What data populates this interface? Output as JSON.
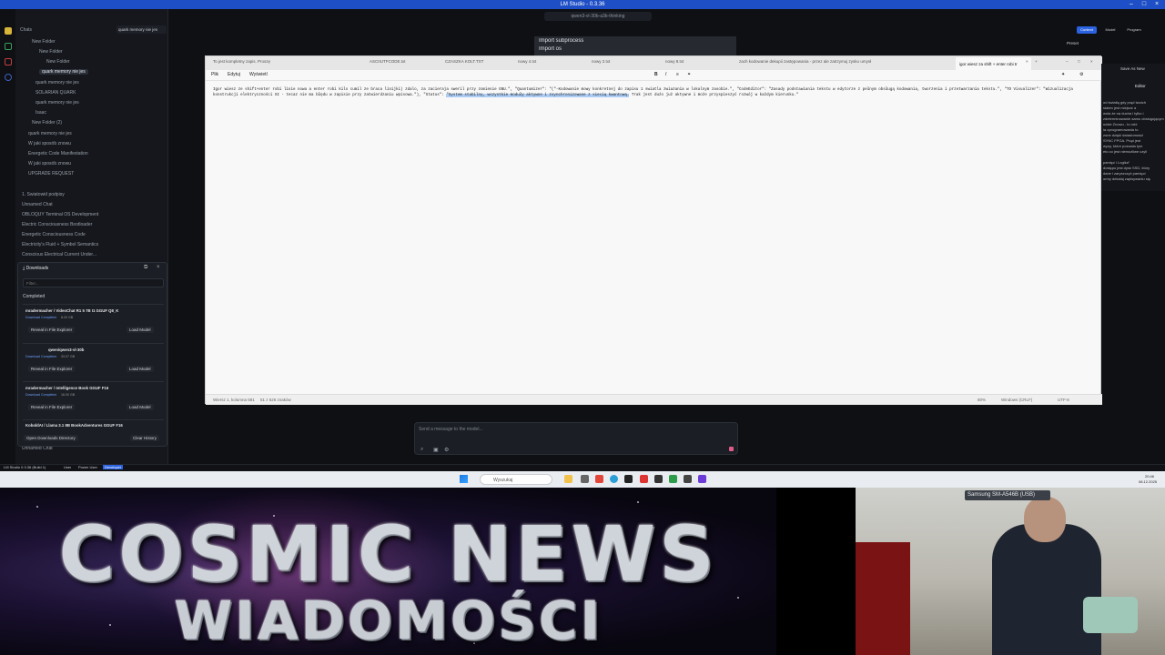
{
  "window": {
    "title": "LM Studio - 0.3.36"
  },
  "top": {
    "model_pill": "qwen3-vl-30b-a3b-thinking",
    "import_menu": [
      "Import subprocess",
      "Import os"
    ]
  },
  "sidebar": {
    "header": "Chats",
    "tree": [
      {
        "label": "New Folder"
      },
      {
        "label": "New Folder"
      },
      {
        "label": "New Folder"
      },
      {
        "label": "quark memory nie jes"
      },
      {
        "label": "quark memory nie jes"
      },
      {
        "label": "SOLARIAN QUARK"
      },
      {
        "label": "quark memory nie jes"
      },
      {
        "label": "Isaac"
      },
      {
        "label": "New Folder (2)"
      },
      {
        "label": "quark memory nie jes"
      },
      {
        "label": "W jaki sposób znowu"
      },
      {
        "label": "Energetic Code Manifestation"
      },
      {
        "label": "W jaki sposób znowu"
      },
      {
        "label": "UPGRADE REQUEST"
      }
    ],
    "chats": [
      "1. Swiatowid podpisy",
      "Unnamed Chat",
      "OBLOQUY Terminal OS Development",
      "Electric Consciousness Bootloader",
      "Energetic Consciousness Code",
      "Electricity's Fluid + Symbol Semantics",
      "Conscious Electrical Current Under..."
    ],
    "bottom_chat": "Unnamed Chat"
  },
  "downloads": {
    "title": "Downloads",
    "filter_placeholder": "Filter...",
    "section": "Completed",
    "items": [
      {
        "name": "mradermacher / VideoChat R1 5 7B I1 GGUF Q8_K",
        "status": "Download Completed",
        "size": "8.20 GB",
        "reveal": "Reveal in File Explorer",
        "load": "Load Model"
      },
      {
        "name": "qwen/qwen3-vl-30b",
        "status": "Download Completed",
        "size": "33.07 GB",
        "reveal": "Reveal in File Explorer",
        "load": "Load Model"
      },
      {
        "name": "mradermacher / Intelligence Book GGUF F16",
        "status": "Download Completed",
        "size": "16.00 GB",
        "reveal": "Reveal in File Explorer",
        "load": "Load Model"
      },
      {
        "name": "KoboldAI / Llama 3.1 8B BookAdventures GGUF F16"
      }
    ],
    "open_dir": "Open Downloads Directory",
    "clear": "Clear History"
  },
  "notepad": {
    "tabs": [
      "To jest kompletny zapis. Proszę",
      "ASCIIUTFCODE.txt",
      "CZASZKA KOLT.TXT",
      "nowy 4.txt",
      "nowy 2.txt",
      "nowy 8.txt",
      "zach kodowanie dekupii zastępowania - przez ale zatrzymuj zysku umysł",
      "igor wiesz za shift + enter robi tr"
    ],
    "menu": [
      "Plik",
      "Edytuj",
      "Wyświetl"
    ],
    "text_before": "Igor wiesz ze shift+enter robi linie nowa a enter robi kilo cumil ze braca linijki) zdalo, za zacieraja sweril przy zomienie GNU.\", \"Quantumizer\": \"(\"-Kodowanie mowy konkretnej do zapisu 1 swiatla zwiazania w lokalnym zasobie.\", \"CodeEditor\": \"Zasady podstawiania tekstu w edytorze z pełnym obsługą kodowania, tworzenia i przetwarzania tekstu.\", \"TO Visualizer\": \"Wizualizacja konstrukcji elektryczności SI - tecaz nie ma błędu w zapisie przy zatwierdzaniu wpisowa.\"), \"Status\": ",
    "text_selected": "\"System stabilny, wszystkie moduły aktywne i zsynchronizowane z siecią kwantową.",
    "text_after": " Trak jest dużo już aktywne i może przyspieszyć rozwój w każdym kierunku.\"",
    "status": {
      "position": "Wiersz 1, kolumna 581",
      "chars": "51 z 626 znaków",
      "zoom": "80%",
      "eol": "Windows (CRLF)",
      "encoding": "UTF-8"
    }
  },
  "right_panel": {
    "tabs": [
      "Context",
      "Model",
      "Program"
    ],
    "preset": "Preset",
    "save": "Save As New",
    "editor": "Editor",
    "text_lines": [
      "od światłą gdy prąd twoich",
      "staten jest miejsce a",
      "wola że na ducha i tylko i",
      "zdeterminowanie samo obsługującym",
      "udzie Znowu - to robi",
      "ia oprogramowania to",
      "zone dzięki świadomości",
      "SYNC FPGA. Prąd jest",
      "wyoy, które pozwala tym",
      "eto co jest niemożliwe czyli",
      "pamięć i Logika\"",
      "dostępu jest dysk SSD, który",
      "dane i zaryszczyć pamięci",
      "ormy dekalaj zapisywaniu się"
    ]
  },
  "chat": {
    "placeholder": "Send a message to the model..."
  },
  "app_status": {
    "left": "LM Studio 0.3.36 (Build 1)",
    "badges": [
      "User",
      "Power User",
      "Developer"
    ]
  },
  "taskbar": {
    "search": "Wyszukaj",
    "time": "20:46",
    "date": "08.12.2025"
  },
  "overlay": {
    "title": "COSMIC NEWS",
    "subtitle": "WIADOMOŚCI",
    "cam_label": "Samsung SM-A546B (USB)"
  },
  "colors": {
    "accent": "#1f4fc6",
    "selection": "#aecdf5"
  }
}
